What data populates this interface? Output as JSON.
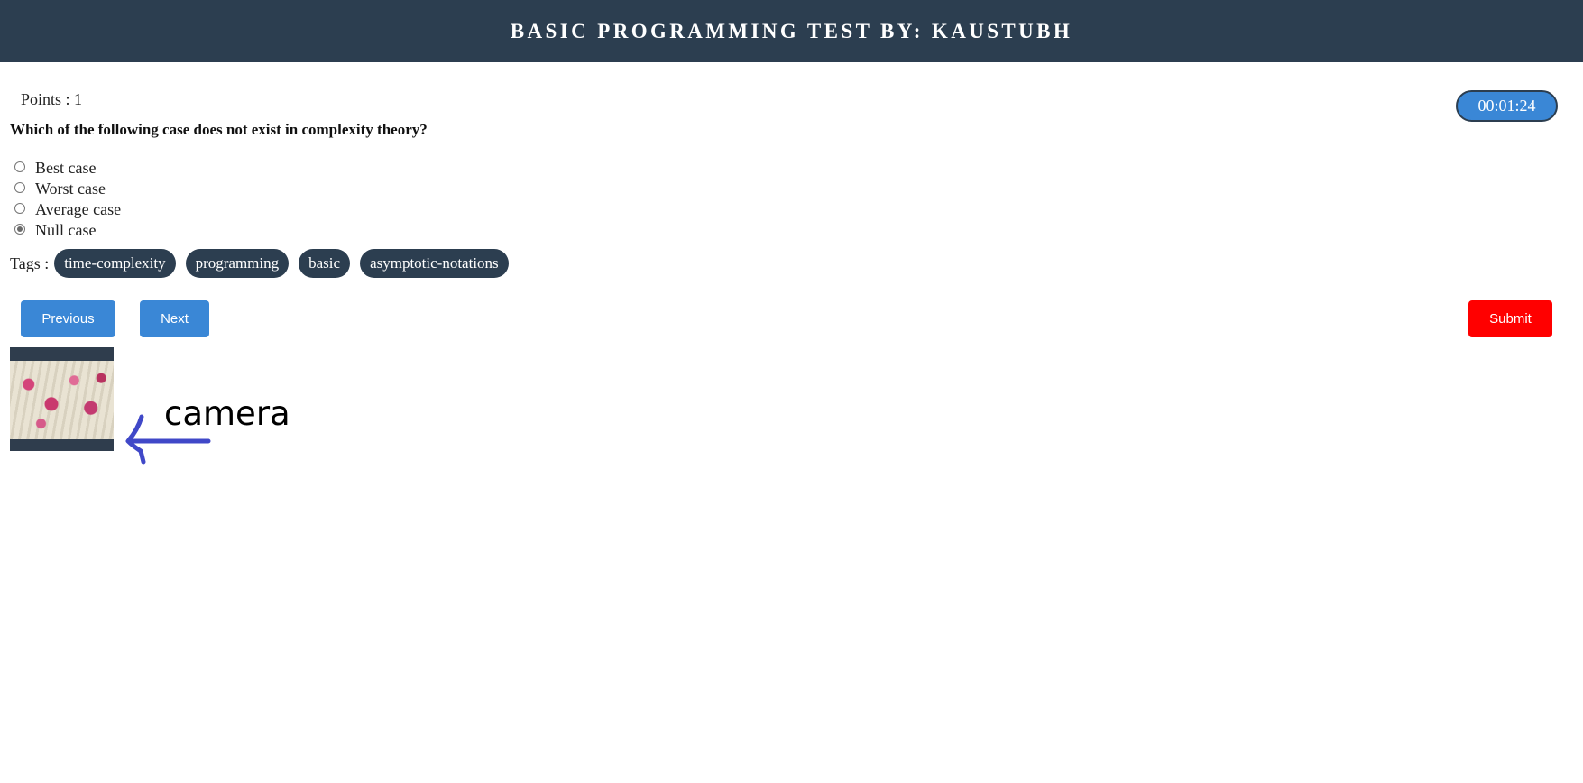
{
  "header": {
    "title": "BASIC PROGRAMMING TEST BY: KAUSTUBH"
  },
  "points": "Points : 1",
  "timer": "00:01:24",
  "question": "Which of the following case does not exist in complexity theory?",
  "options": [
    {
      "label": "Best case",
      "selected": false
    },
    {
      "label": "Worst case",
      "selected": false
    },
    {
      "label": "Average case",
      "selected": false
    },
    {
      "label": "Null case",
      "selected": true
    }
  ],
  "tags": {
    "label": "Tags :",
    "items": [
      "time-complexity",
      "programming",
      "basic",
      "asymptotic-notations"
    ]
  },
  "buttons": {
    "previous": "Previous",
    "next": "Next",
    "submit": "Submit"
  },
  "annotation": {
    "camera_label": "camera",
    "arrow_color": "#4048c8"
  },
  "colors": {
    "header_bg": "#2c3e50",
    "primary": "#3a87d6",
    "danger": "#ff0000"
  }
}
